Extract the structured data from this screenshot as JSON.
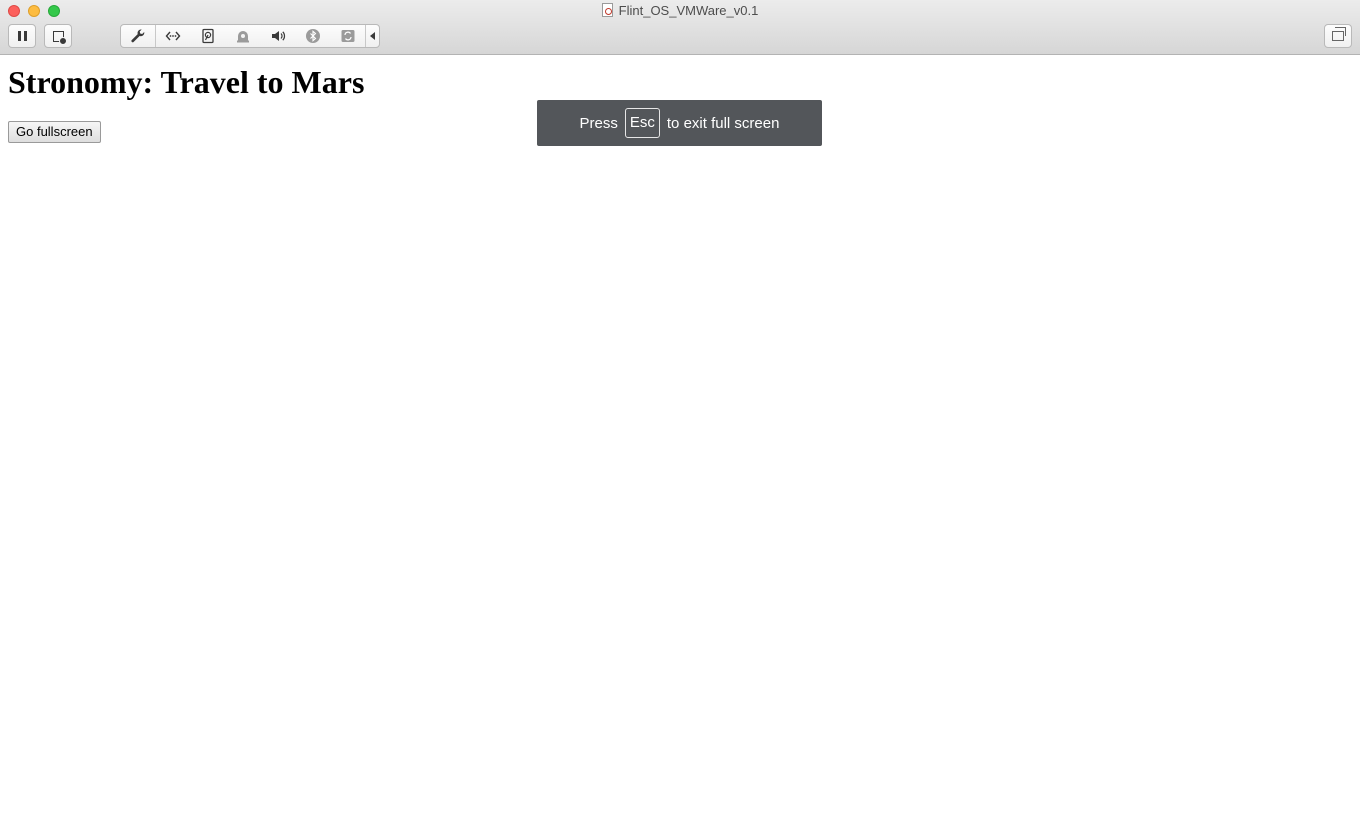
{
  "window": {
    "title": "Flint_OS_VMWare_v0.1"
  },
  "toolbar": {
    "items": [
      {
        "icon": "wrench-icon"
      },
      {
        "icon": "network-icon"
      },
      {
        "icon": "harddisk-icon"
      },
      {
        "icon": "camera-icon"
      },
      {
        "icon": "sound-icon"
      },
      {
        "icon": "bluetooth-icon"
      },
      {
        "icon": "usb-sync-icon"
      }
    ]
  },
  "page": {
    "heading": "Stronomy: Travel to Mars",
    "fullscreen_button": "Go fullscreen"
  },
  "toast": {
    "prefix": "Press",
    "key": "Esc",
    "suffix": "to exit full screen"
  }
}
